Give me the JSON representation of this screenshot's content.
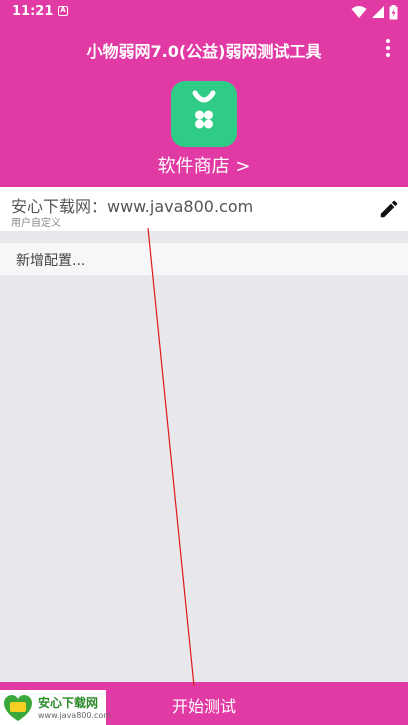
{
  "status_bar": {
    "time": "11:21",
    "notification_glyph": "A",
    "icons": [
      "wifi-icon",
      "signal-icon",
      "battery-icon"
    ]
  },
  "app_bar": {
    "title": "小物弱网7.0(公益)弱网测试工具",
    "menu_icon": "more-vert-icon"
  },
  "store": {
    "icon": "app-store-icon",
    "link_label": "软件商店 >"
  },
  "configs": [
    {
      "title": "安心下载网：www.java800.com",
      "subtitle": "用户自定义",
      "edit_icon": "pencil-icon"
    }
  ],
  "add_config_label": "新增配置...",
  "bottom_bar": {
    "start_label": "开始测试"
  },
  "watermark": {
    "name": "安心下载网",
    "url": "www.java800.com",
    "logo_icon": "anxin-logo-icon"
  },
  "colors": {
    "primary": "#e23aa5",
    "store_icon_bg": "#2ecc86",
    "background": "#e7e7ec"
  }
}
